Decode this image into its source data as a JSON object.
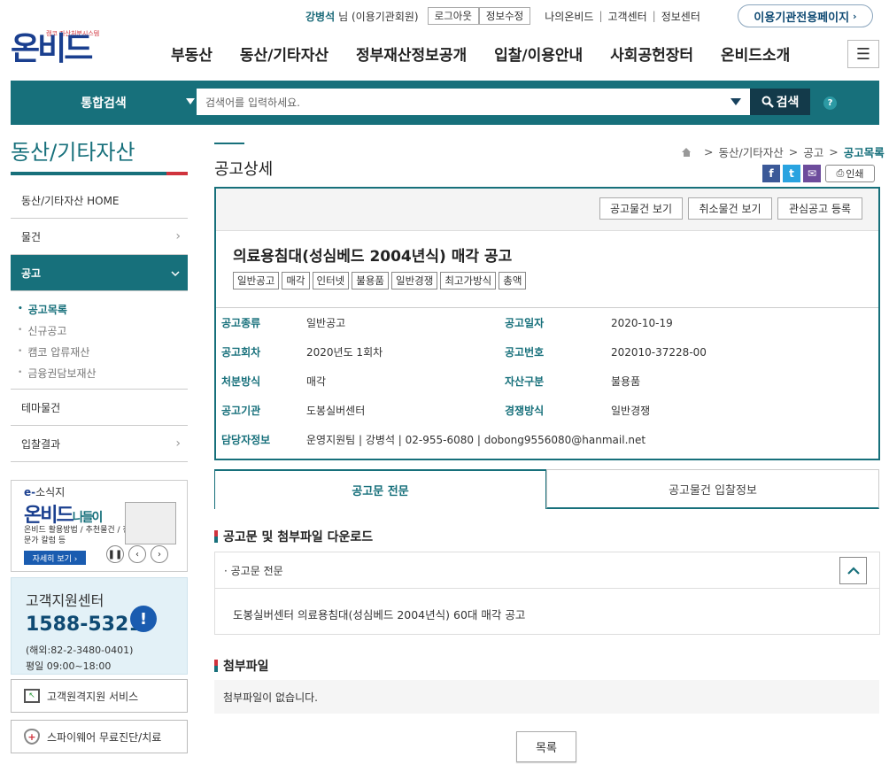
{
  "util": {
    "user_name": "강병석",
    "user_suffix": "님 (이용기관회원)",
    "logout_label": "로그아웃",
    "profile_label": "정보수정",
    "links": [
      "나의온비드",
      "고객센터",
      "정보센터"
    ],
    "inst_page_label": "이용기관전용페이지"
  },
  "logo": {
    "tagline": "캠코 자산처분시스템",
    "name": "온비드"
  },
  "gnb": [
    "부동산",
    "동산/기타자산",
    "정부재산정보공개",
    "입찰/이용안내",
    "사회공헌장터",
    "온비드소개"
  ],
  "search": {
    "category": "통합검색",
    "placeholder": "검색어를 입력하세요.",
    "button": "검색",
    "help": "?"
  },
  "sidebar": {
    "title": "동산/기타자산",
    "items": [
      {
        "label": "동산/기타자산 HOME"
      },
      {
        "label": "물건"
      },
      {
        "label": "공고"
      },
      {
        "label": "테마물건"
      },
      {
        "label": "입찰결과"
      }
    ],
    "subitems": [
      "공고목록",
      "신규공고",
      "캠코 압류재산",
      "금융권담보재산"
    ]
  },
  "banner_ebook": {
    "prefix": "e-",
    "title_small": "소식지",
    "title_big": "온비드",
    "title_suffix": "나들이",
    "desc": "온비드 활용방법 / 추천물건 / 전문가 칼럼 등",
    "more": "자세히 보기 ›"
  },
  "banner_support": {
    "title": "고객지원센터",
    "phone": "1588-5321",
    "overseas": "(해외:82-2-3480-0401)",
    "hours": "평일 09:00~18:00"
  },
  "side_buttons": {
    "remote": "고객원격지원 서비스",
    "spyware": "스파이웨어 무료진단/치료"
  },
  "page": {
    "title": "공고상세",
    "breadcrumb": [
      "동산/기타자산",
      "공고",
      "공고목록"
    ],
    "print": "인쇄"
  },
  "notice": {
    "buttons": [
      "공고물건 보기",
      "취소물건 보기",
      "관심공고 등록"
    ],
    "title": "의료용침대(성심베드 2004년식) 매각 공고",
    "tags": [
      "일반공고",
      "매각",
      "인터넷",
      "불용품",
      "일반경쟁",
      "최고가방식",
      "총액"
    ],
    "info": {
      "type_label": "공고종류",
      "type": "일반공고",
      "date_label": "공고일자",
      "date": "2020-10-19",
      "round_label": "공고회차",
      "round": "2020년도 1회차",
      "no_label": "공고번호",
      "no": "202010-37228-00",
      "method_label": "처분방식",
      "method": "매각",
      "asset_label": "자산구분",
      "asset": "불용품",
      "org_label": "공고기관",
      "org": "도봉실버센터",
      "compete_label": "경쟁방식",
      "compete": "일반경쟁",
      "contact_label": "담당자정보",
      "contact": "운영지원팀 | 강병석 | 02-955-6080 | dobong9556080@hanmail.net"
    }
  },
  "tabs": [
    "공고문 전문",
    "공고물건 입찰정보"
  ],
  "download": {
    "heading": "공고문 및 첨부파일 다운로드",
    "accordion_title": "· 공고문 전문",
    "accordion_body": "도봉실버센터 의료용침대(성심베드 2004년식) 60대 매각 공고"
  },
  "attachments": {
    "heading": "첨부파일",
    "empty": "첨부파일이 없습니다."
  },
  "list_button": "목록"
}
